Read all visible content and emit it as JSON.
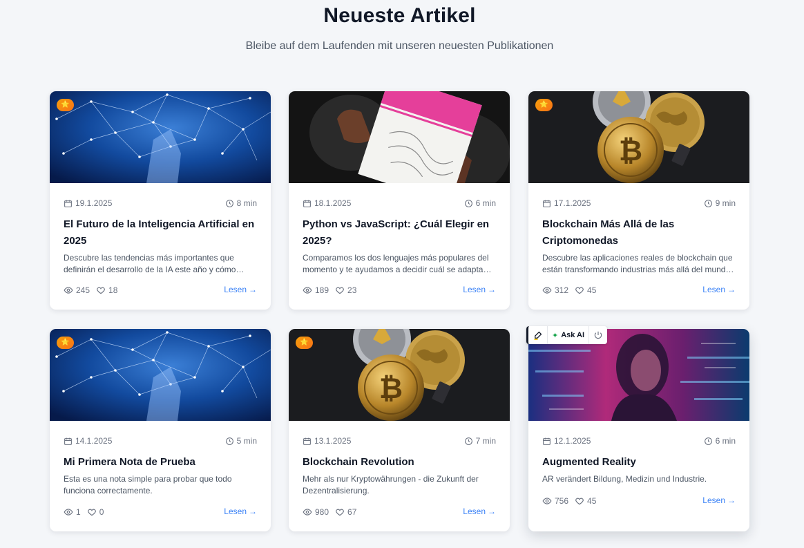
{
  "header": {
    "title": "Neueste Artikel",
    "subtitle": "Bleibe auf dem Laufenden mit unseren neuesten Publikationen"
  },
  "read_label": "Lesen",
  "featured_badge": "⭐",
  "toolbar": {
    "ask_label": "Ask AI"
  },
  "articles": [
    {
      "date": "19.1.2025",
      "read_time": "8 min",
      "title": "El Futuro de la Inteligencia Artificial en 2025",
      "description": "Descubre las tendencias más importantes que definirán el desarrollo de la IA este año y cómo afectarán a la industria.",
      "views": "245",
      "likes": "18",
      "image": "ai-network",
      "featured": true
    },
    {
      "date": "18.1.2025",
      "read_time": "6 min",
      "title": "Python vs JavaScript: ¿Cuál Elegir en 2025?",
      "description": "Comparamos los dos lenguajes más populares del momento y te ayudamos a decidir cuál se adapta mejor a tus necesidades.",
      "views": "189",
      "likes": "23",
      "image": "python-book",
      "featured": false
    },
    {
      "date": "17.1.2025",
      "read_time": "9 min",
      "title": "Blockchain Más Allá de las Criptomonedas",
      "description": "Descubre las aplicaciones reales de blockchain que están transformando industrias más allá del mundo financiero.",
      "views": "312",
      "likes": "45",
      "image": "crypto-coins",
      "featured": true
    },
    {
      "date": "14.1.2025",
      "read_time": "5 min",
      "title": "Mi Primera Nota de Prueba",
      "description": "Esta es una nota simple para probar que todo funciona correctamente.",
      "views": "1",
      "likes": "0",
      "image": "ai-network",
      "featured": true
    },
    {
      "date": "13.1.2025",
      "read_time": "7 min",
      "title": "Blockchain Revolution",
      "description": "Mehr als nur Kryptowährungen - die Zukunft der Dezentralisierung.",
      "views": "980",
      "likes": "67",
      "image": "crypto-coins",
      "featured": true
    },
    {
      "date": "12.1.2025",
      "read_time": "6 min",
      "title": "Augmented Reality",
      "description": "AR verändert Bildung, Medizin und Industrie.",
      "views": "756",
      "likes": "45",
      "image": "ar-person",
      "featured": false
    }
  ]
}
